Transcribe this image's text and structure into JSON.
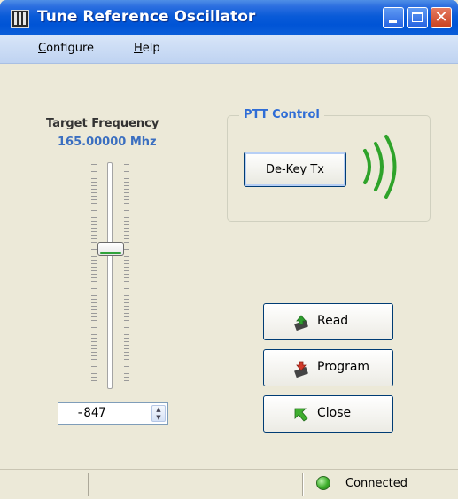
{
  "window": {
    "title": "Tune Reference Oscillator",
    "minimize_label": "minimize",
    "maximize_label": "maximize",
    "close_label": "close"
  },
  "menu": {
    "items": [
      {
        "label_mnemonic": "C",
        "label_rest": "onfigure"
      },
      {
        "label_mnemonic": "H",
        "label_rest": "elp"
      }
    ]
  },
  "frequency": {
    "label": "Target Frequency",
    "value": "165.00000 Mhz",
    "slider_level": 0.62,
    "offset_value": "-847"
  },
  "ptt": {
    "group_label": "PTT Control",
    "dekey_label": "De-Key Tx",
    "signal_color": "#2fa32a"
  },
  "actions": {
    "read_label": "Read",
    "program_label": "Program",
    "close_label": "Close"
  },
  "status": {
    "connection_text": "Connected",
    "connection_color": "#3cae2a"
  },
  "colors": {
    "titlebar": "#0a5bd8",
    "accent_blue": "#2f6dd6",
    "window_bg": "#ece9d8"
  }
}
